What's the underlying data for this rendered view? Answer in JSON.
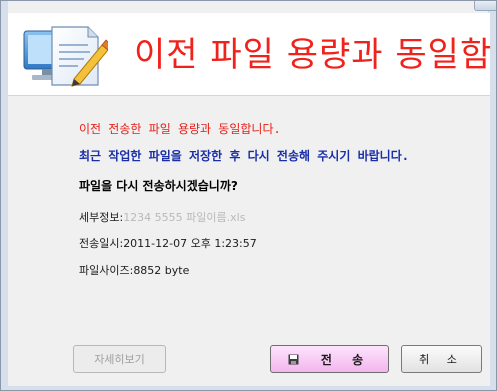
{
  "header": {
    "title": "이전 파일 용량과 동일함",
    "icon": "document-pencil-icon"
  },
  "messages": {
    "warning": "이전 전송한 파일 용량과 동일합니다.",
    "advice": "최근 작업한 파일을 저장한 후 다시 전송해 주시기 바랍니다.",
    "question": "파일을 다시 전송하시겠습니까?"
  },
  "info": {
    "detail_label": "세부정보:",
    "detail_value": "1234 5555 파일이름.xls",
    "datetime_label": "전송일시:",
    "datetime_value": "2011-12-07 오후 1:23:57",
    "filesize_label": "파일사이즈:",
    "filesize_value": "8852 byte"
  },
  "buttons": {
    "detail": "자세히보기",
    "send": "전 송",
    "cancel": "취 소"
  },
  "colors": {
    "title_red": "#f0221c",
    "warning_red": "#e8201a",
    "advice_blue": "#1a2ea8",
    "send_button_pink": "#f4b5ef"
  }
}
